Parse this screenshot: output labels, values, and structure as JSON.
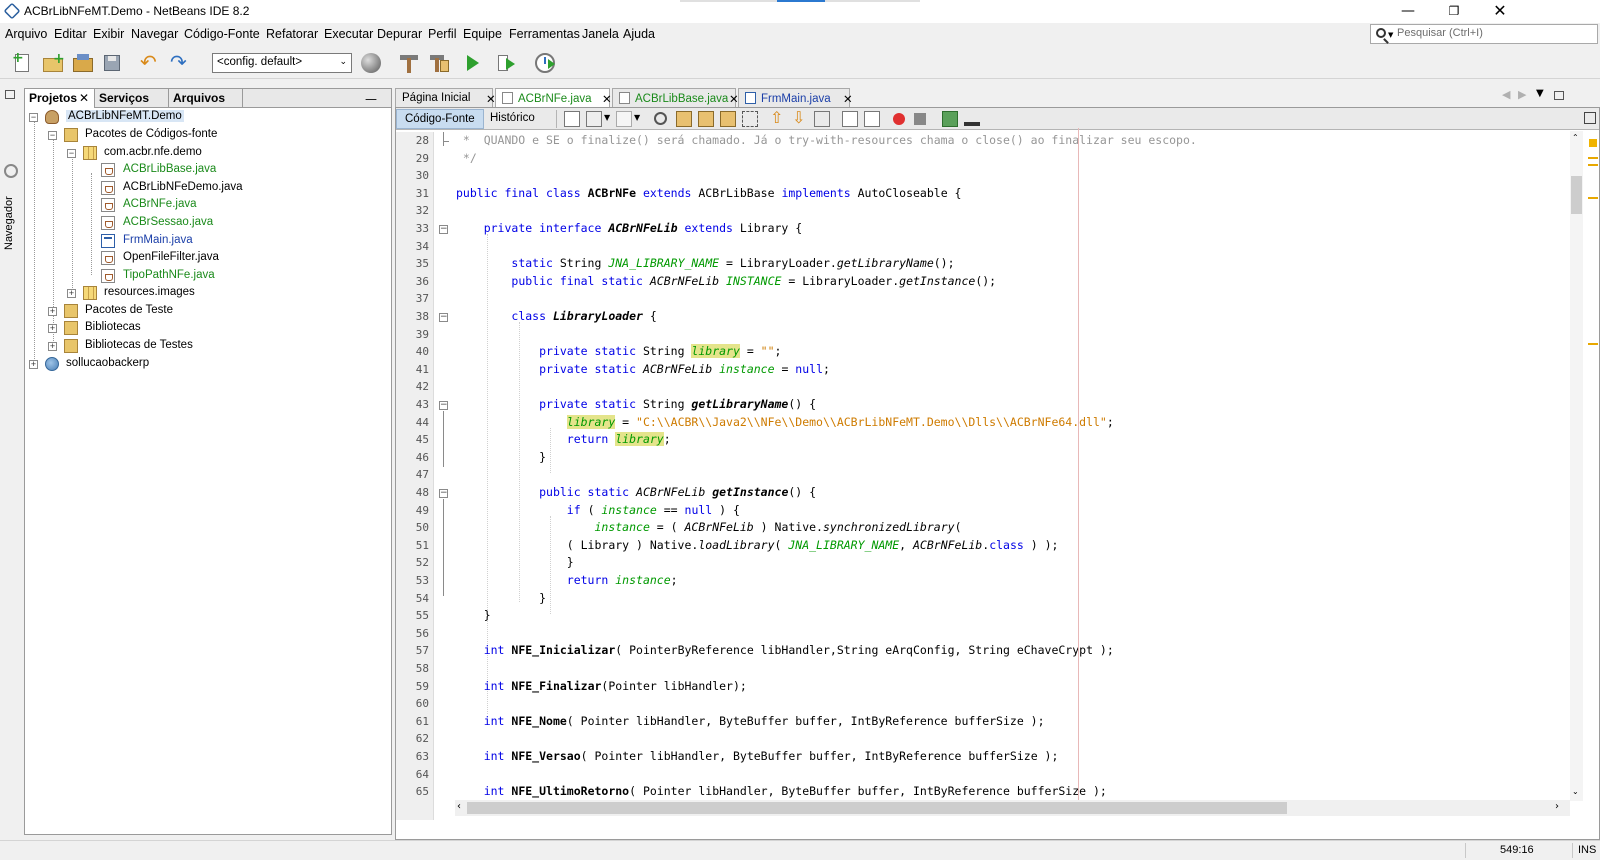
{
  "window": {
    "title": "ACBrLibNFeMT.Demo - NetBeans IDE 8.2"
  },
  "menu": [
    "Arquivo",
    "Editar",
    "Exibir",
    "Navegar",
    "Código-Fonte",
    "Refatorar",
    "Executar",
    "Depurar",
    "Perfil",
    "Equipe",
    "Ferramentas",
    "Janela",
    "Ajuda"
  ],
  "search": {
    "placeholder": "Pesquisar (Ctrl+I)"
  },
  "toolbar": {
    "config": "<config. default>"
  },
  "side_strip": {
    "label": "Navegador"
  },
  "project_tabs": [
    "Projetos",
    "Serviços",
    "Arquivos"
  ],
  "tree": [
    {
      "label": "ACBrLibNFeMT.Demo",
      "color": "#000000",
      "icon": "project-icon"
    },
    {
      "label": "Pacotes de Códigos-fonte",
      "color": "#000000",
      "icon": "source-packages-icon"
    },
    {
      "label": "com.acbr.nfe.demo",
      "color": "#000000",
      "icon": "package-icon"
    },
    {
      "label": "ACBrLibBase.java",
      "color": "#1a8a1a",
      "icon": "java-file-icon"
    },
    {
      "label": "ACBrLibNFeDemo.java",
      "color": "#000000",
      "icon": "java-main-file-icon"
    },
    {
      "label": "ACBrNFe.java",
      "color": "#1a8a1a",
      "icon": "java-file-icon"
    },
    {
      "label": "ACBrSessao.java",
      "color": "#1a8a1a",
      "icon": "java-file-icon"
    },
    {
      "label": "FrmMain.java",
      "color": "#1a3ea8",
      "icon": "form-file-icon"
    },
    {
      "label": "OpenFileFilter.java",
      "color": "#000000",
      "icon": "java-file-icon"
    },
    {
      "label": "TipoPathNFe.java",
      "color": "#1a8a1a",
      "icon": "java-file-icon"
    },
    {
      "label": "resources.images",
      "color": "#000000",
      "icon": "package-icon"
    },
    {
      "label": "Pacotes de Teste",
      "color": "#000000",
      "icon": "test-packages-icon"
    },
    {
      "label": "Bibliotecas",
      "color": "#000000",
      "icon": "libraries-icon"
    },
    {
      "label": "Bibliotecas de Testes",
      "color": "#000000",
      "icon": "test-libraries-icon"
    },
    {
      "label": "sollucaobackerp",
      "color": "#000000",
      "icon": "globe-project-icon"
    }
  ],
  "editor_tabs": [
    {
      "label": "Página Inicial",
      "color": "#000000"
    },
    {
      "label": "ACBrNFe.java",
      "color": "#1a8a1a"
    },
    {
      "label": "ACBrLibBase.java",
      "color": "#1a8a1a"
    },
    {
      "label": "FrmMain.java",
      "color": "#1a3ea8"
    }
  ],
  "view_tabs": [
    "Código-Fonte",
    "Histórico"
  ],
  "code": {
    "line_numbers": [
      "28",
      "29",
      "30",
      "31",
      "32",
      "33",
      "34",
      "35",
      "36",
      "37",
      "38",
      "39",
      "40",
      "41",
      "42",
      "43",
      "44",
      "45",
      "46",
      "47",
      "48",
      "49",
      "50",
      "51",
      "52",
      "53",
      "54",
      "55",
      "56",
      "57",
      "58",
      "59",
      "60",
      "61",
      "62",
      "63",
      "64",
      "65"
    ],
    "lines": [
      [
        [
          "cm",
          " *  QUANDO e SE o finalize() será chamado. Já o try-with-resources chama o close() ao finalizar seu escopo."
        ]
      ],
      [
        [
          "cm",
          " */"
        ]
      ],
      [],
      [
        [
          "kw",
          "public final class "
        ],
        [
          "b",
          "ACBrNFe "
        ],
        [
          "kw",
          "extends "
        ],
        [
          "",
          "ACBrLibBase "
        ],
        [
          "kw",
          "implements "
        ],
        [
          "",
          "AutoCloseable {"
        ]
      ],
      [],
      [
        [
          "",
          "    "
        ],
        [
          "kw",
          "private interface "
        ],
        [
          "b it",
          "ACBrNFeLib "
        ],
        [
          "kw",
          "extends "
        ],
        [
          "",
          "Library {"
        ]
      ],
      [],
      [
        [
          "",
          "        "
        ],
        [
          "kw",
          "static "
        ],
        [
          "",
          "String "
        ],
        [
          "fld",
          "JNA_LIBRARY_NAME"
        ],
        [
          "",
          " = LibraryLoader."
        ],
        [
          "it",
          "getLibraryName"
        ],
        [
          "",
          "();"
        ]
      ],
      [
        [
          "",
          "        "
        ],
        [
          "kw",
          "public final static "
        ],
        [
          "it",
          "ACBrNFeLib "
        ],
        [
          "fld",
          "INSTANCE"
        ],
        [
          "",
          " = LibraryLoader."
        ],
        [
          "it",
          "getInstance"
        ],
        [
          "",
          "();"
        ]
      ],
      [],
      [
        [
          "",
          "        "
        ],
        [
          "kw",
          "class "
        ],
        [
          "b it",
          "LibraryLoader"
        ],
        [
          "",
          " {"
        ]
      ],
      [],
      [
        [
          "",
          "            "
        ],
        [
          "kw",
          "private static "
        ],
        [
          "",
          "String "
        ],
        [
          "fld hl",
          "library"
        ],
        [
          "",
          " = "
        ],
        [
          "st",
          "\"\""
        ],
        [
          "",
          ";"
        ]
      ],
      [
        [
          "",
          "            "
        ],
        [
          "kw",
          "private static "
        ],
        [
          "it",
          "ACBrNFeLib "
        ],
        [
          "fld",
          "instance"
        ],
        [
          "",
          " = "
        ],
        [
          "kw",
          "null"
        ],
        [
          "",
          ";"
        ]
      ],
      [],
      [
        [
          "",
          "            "
        ],
        [
          "kw",
          "private static "
        ],
        [
          "",
          "String "
        ],
        [
          "b it",
          "getLibraryName"
        ],
        [
          "",
          "() {"
        ]
      ],
      [
        [
          "",
          "                "
        ],
        [
          "fld hl",
          "library"
        ],
        [
          "",
          " = "
        ],
        [
          "st",
          "\"C:\\\\ACBR\\\\Java2\\\\NFe\\\\Demo\\\\ACBrLibNFeMT.Demo\\\\Dlls\\\\ACBrNFe64.dll\""
        ],
        [
          "",
          ";"
        ]
      ],
      [
        [
          "",
          "                "
        ],
        [
          "kw",
          "return "
        ],
        [
          "fld hl",
          "library"
        ],
        [
          "",
          ";"
        ]
      ],
      [
        [
          "",
          "            }"
        ]
      ],
      [],
      [
        [
          "",
          "            "
        ],
        [
          "kw",
          "public static "
        ],
        [
          "it",
          "ACBrNFeLib "
        ],
        [
          "b it",
          "getInstance"
        ],
        [
          "",
          "() {"
        ]
      ],
      [
        [
          "",
          "                "
        ],
        [
          "kw",
          "if "
        ],
        [
          "",
          "( "
        ],
        [
          "fld",
          "instance"
        ],
        [
          "",
          " == "
        ],
        [
          "kw",
          "null"
        ],
        [
          "",
          " ) {"
        ]
      ],
      [
        [
          "",
          "                    "
        ],
        [
          "fld",
          "instance"
        ],
        [
          "",
          " = ( "
        ],
        [
          "it",
          "ACBrNFeLib"
        ],
        [
          "",
          " ) Native."
        ],
        [
          "it",
          "synchronizedLibrary"
        ],
        [
          "",
          "("
        ]
      ],
      [
        [
          "",
          "                ( Library ) Native."
        ],
        [
          "it",
          "loadLibrary"
        ],
        [
          "",
          "( "
        ],
        [
          "fld",
          "JNA_LIBRARY_NAME"
        ],
        [
          "",
          ", "
        ],
        [
          "it",
          "ACBrNFeLib"
        ],
        [
          "",
          "."
        ],
        [
          "kw",
          "class"
        ],
        [
          "",
          " ) );"
        ]
      ],
      [
        [
          "",
          "                }"
        ]
      ],
      [
        [
          "",
          "                "
        ],
        [
          "kw",
          "return "
        ],
        [
          "fld",
          "instance"
        ],
        [
          "",
          ";"
        ]
      ],
      [
        [
          "",
          "            }"
        ]
      ],
      [
        [
          "",
          "    }"
        ]
      ],
      [],
      [
        [
          "",
          "    "
        ],
        [
          "kw",
          "int "
        ],
        [
          "b",
          "NFE_Inicializar"
        ],
        [
          "",
          "( PointerByReference libHandler,String eArqConfig, String eChaveCrypt );"
        ]
      ],
      [],
      [
        [
          "",
          "    "
        ],
        [
          "kw",
          "int "
        ],
        [
          "b",
          "NFE_Finalizar"
        ],
        [
          "",
          "(Pointer libHandler);"
        ]
      ],
      [],
      [
        [
          "",
          "    "
        ],
        [
          "kw",
          "int "
        ],
        [
          "b",
          "NFE_Nome"
        ],
        [
          "",
          "( Pointer libHandler, ByteBuffer buffer, IntByReference bufferSize );"
        ]
      ],
      [],
      [
        [
          "",
          "    "
        ],
        [
          "kw",
          "int "
        ],
        [
          "b",
          "NFE_Versao"
        ],
        [
          "",
          "( Pointer libHandler, ByteBuffer buffer, IntByReference bufferSize );"
        ]
      ],
      [],
      [
        [
          "",
          "    "
        ],
        [
          "kw",
          "int "
        ],
        [
          "b",
          "NFE_UltimoRetorno"
        ],
        [
          "",
          "( Pointer libHandler, ByteBuffer buffer, IntByReference bufferSize );"
        ]
      ]
    ]
  },
  "status": {
    "position": "549:16",
    "mode": "INS"
  }
}
